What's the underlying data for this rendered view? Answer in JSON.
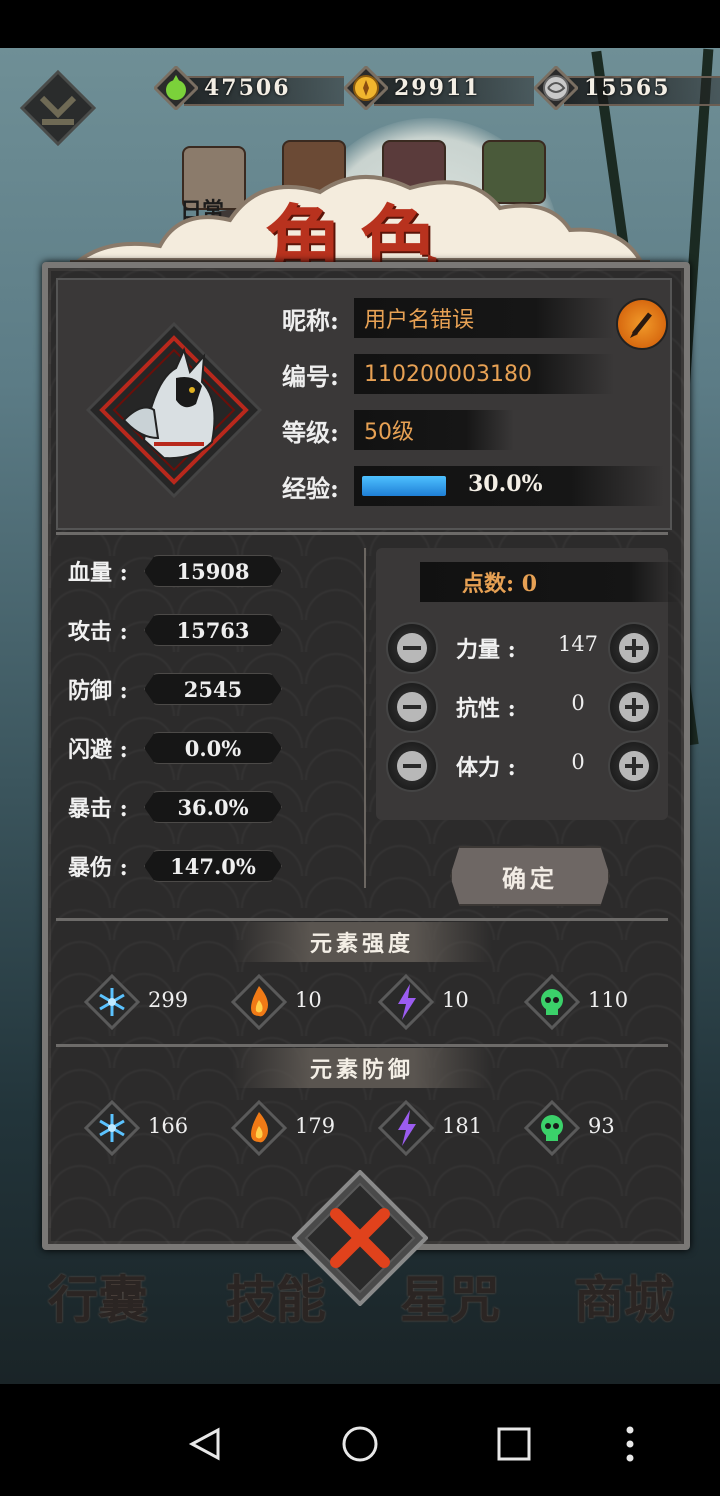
{
  "resources": [
    {
      "icon": "green-drop-icon",
      "value": "47506"
    },
    {
      "icon": "gold-coin-icon",
      "value": "29911"
    },
    {
      "icon": "silver-coin-icon",
      "value": "15565"
    }
  ],
  "top_tabs": {
    "daily_label": "日常"
  },
  "title": "角色",
  "profile": {
    "nickname_label": "昵称:",
    "nickname": "用户名错误",
    "id_label": "编号:",
    "id": "110200003180",
    "level_label": "等级:",
    "level": "50级",
    "exp_label": "经验:",
    "exp_text": "30.0%",
    "exp_fraction": 0.3
  },
  "stats": [
    {
      "label": "血量 :",
      "value": "15908"
    },
    {
      "label": "攻击 :",
      "value": "15763"
    },
    {
      "label": "防御 :",
      "value": "2545"
    },
    {
      "label": "闪避 :",
      "value": "0.0%"
    },
    {
      "label": "暴击 :",
      "value": "36.0%"
    },
    {
      "label": "暴伤 :",
      "value": "147.0%"
    }
  ],
  "points": {
    "header": "点数: 0",
    "attributes": [
      {
        "label": "力量 :",
        "value": "147"
      },
      {
        "label": "抗性 :",
        "value": "0"
      },
      {
        "label": "体力 :",
        "value": "0"
      }
    ],
    "confirm_label": "确定"
  },
  "element_strength": {
    "title": "元素强度",
    "items": [
      {
        "icon": "ice-icon",
        "value": "299"
      },
      {
        "icon": "fire-icon",
        "value": "10"
      },
      {
        "icon": "lightning-icon",
        "value": "10"
      },
      {
        "icon": "poison-skull-icon",
        "value": "110"
      }
    ]
  },
  "element_defense": {
    "title": "元素防御",
    "items": [
      {
        "icon": "ice-icon",
        "value": "166"
      },
      {
        "icon": "fire-icon",
        "value": "179"
      },
      {
        "icon": "lightning-icon",
        "value": "181"
      },
      {
        "icon": "poison-skull-icon",
        "value": "93"
      }
    ]
  },
  "bottom_tabs": [
    "行囊",
    "技能",
    "星咒",
    "商城"
  ],
  "colors": {
    "title_red": "#b8321e",
    "value_orange": "#e7a154",
    "exp_blue": "#2f9ff0",
    "panel_bg": "#2c2b2b"
  }
}
